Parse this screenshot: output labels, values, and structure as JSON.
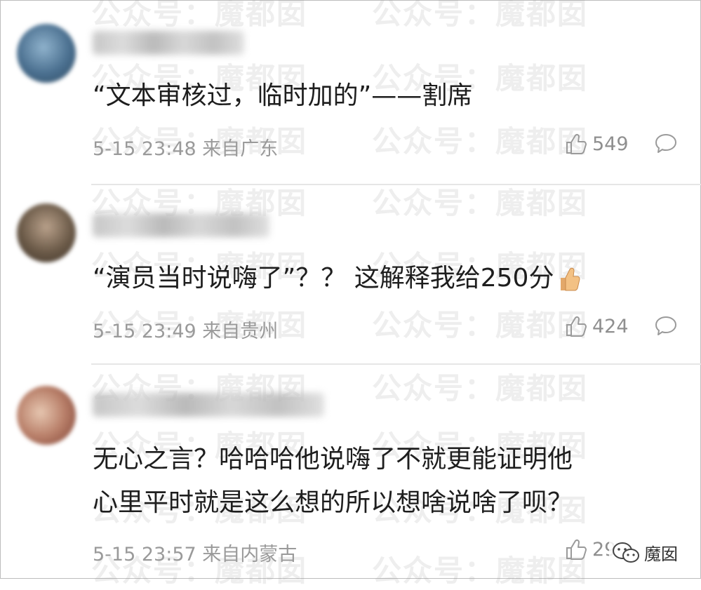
{
  "watermark": {
    "text": "公众号：魔都囡"
  },
  "comments": [
    {
      "text_lines": [
        "“文本审核过，临时加的”——割席"
      ],
      "time": "5-15 23:48",
      "location": "来自广东",
      "likes": "549",
      "avatar_color": "#4a6f8f"
    },
    {
      "text_lines": [
        "“演员当时说嗨了”？？ 这解释我给250分"
      ],
      "time": "5-15 23:49",
      "location": "来自贵州",
      "likes": "424",
      "avatar_color": "#6b5a48"
    },
    {
      "text_lines": [
        "无心之言？哈哈哈他说嗨了不就更能证明他",
        "心里平时就是这么想的所以想啥说啥了呗？"
      ],
      "time": "5-15 23:57",
      "location": "来自内蒙古",
      "likes": "29",
      "avatar_color": "#b9806a"
    }
  ],
  "brand": {
    "label": "魔囡",
    "icon": "wechat-icon"
  },
  "icons": {
    "like": "thumbs-up-icon",
    "reply": "comment-bubble-icon",
    "emoji": "thumbs-up-emoji"
  },
  "colors": {
    "meta_text": "#9a9a9a",
    "body_text": "#1e1e1e",
    "divider": "#e6e6e6"
  }
}
